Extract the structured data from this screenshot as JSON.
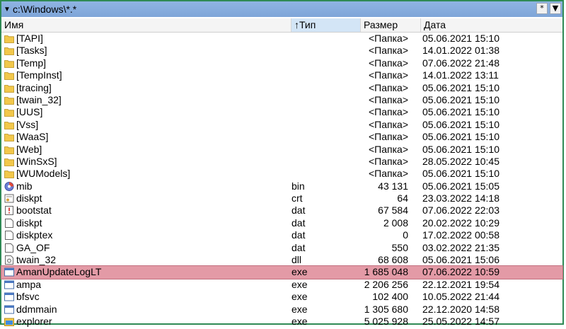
{
  "path": "c:\\Windows\\*.*",
  "buttons": [
    "*",
    "▼"
  ],
  "columns": {
    "name": "Имя",
    "type": "↑Тип",
    "size": "Размер",
    "date": "Дата"
  },
  "rows": [
    {
      "icon": "folder",
      "name": "[TAPI]",
      "ext": "",
      "size": "<Папка>",
      "date": "05.06.2021 15:10"
    },
    {
      "icon": "folder",
      "name": "[Tasks]",
      "ext": "",
      "size": "<Папка>",
      "date": "14.01.2022 01:38"
    },
    {
      "icon": "folder",
      "name": "[Temp]",
      "ext": "",
      "size": "<Папка>",
      "date": "07.06.2022 21:48"
    },
    {
      "icon": "folder",
      "name": "[TempInst]",
      "ext": "",
      "size": "<Папка>",
      "date": "14.01.2022 13:11"
    },
    {
      "icon": "folder",
      "name": "[tracing]",
      "ext": "",
      "size": "<Папка>",
      "date": "05.06.2021 15:10"
    },
    {
      "icon": "folder",
      "name": "[twain_32]",
      "ext": "",
      "size": "<Папка>",
      "date": "05.06.2021 15:10"
    },
    {
      "icon": "folder",
      "name": "[UUS]",
      "ext": "",
      "size": "<Папка>",
      "date": "05.06.2021 15:10"
    },
    {
      "icon": "folder",
      "name": "[Vss]",
      "ext": "",
      "size": "<Папка>",
      "date": "05.06.2021 15:10"
    },
    {
      "icon": "folder",
      "name": "[WaaS]",
      "ext": "",
      "size": "<Папка>",
      "date": "05.06.2021 15:10"
    },
    {
      "icon": "folder",
      "name": "[Web]",
      "ext": "",
      "size": "<Папка>",
      "date": "05.06.2021 15:10"
    },
    {
      "icon": "folder",
      "name": "[WinSxS]",
      "ext": "",
      "size": "<Папка>",
      "date": "28.05.2022 10:45"
    },
    {
      "icon": "folder",
      "name": "[WUModels]",
      "ext": "",
      "size": "<Папка>",
      "date": "05.06.2021 15:10"
    },
    {
      "icon": "disc",
      "name": "mib",
      "ext": "bin",
      "size": "43 131",
      "date": "05.06.2021 15:05"
    },
    {
      "icon": "cert",
      "name": "diskpt",
      "ext": "crt",
      "size": "64",
      "date": "23.03.2022 14:18"
    },
    {
      "icon": "alert",
      "name": "bootstat",
      "ext": "dat",
      "size": "67 584",
      "date": "07.06.2022 22:03"
    },
    {
      "icon": "file",
      "name": "diskpt",
      "ext": "dat",
      "size": "2 008",
      "date": "20.02.2022 10:29"
    },
    {
      "icon": "file",
      "name": "diskptex",
      "ext": "dat",
      "size": "0",
      "date": "17.02.2022 00:58"
    },
    {
      "icon": "file",
      "name": "GA_OF",
      "ext": "dat",
      "size": "550",
      "date": "03.02.2022 21:35"
    },
    {
      "icon": "dll",
      "name": "twain_32",
      "ext": "dll",
      "size": "68 608",
      "date": "05.06.2021 15:06"
    },
    {
      "icon": "exe",
      "name": "AmanUpdateLogLT",
      "ext": "exe",
      "size": "1 685 048",
      "date": "07.06.2022 10:59",
      "selected": true
    },
    {
      "icon": "exe",
      "name": "ampa",
      "ext": "exe",
      "size": "2 206 256",
      "date": "22.12.2021 19:54"
    },
    {
      "icon": "exe",
      "name": "bfsvc",
      "ext": "exe",
      "size": "102 400",
      "date": "10.05.2022 21:44"
    },
    {
      "icon": "exe",
      "name": "ddmmain",
      "ext": "exe",
      "size": "1 305 680",
      "date": "22.12.2020 14:58"
    },
    {
      "icon": "explorer",
      "name": "explorer",
      "ext": "exe",
      "size": "5 025 928",
      "date": "25.05.2022 14:57"
    }
  ],
  "colors": {
    "selected_row": "#e39aa6",
    "folder": "#f2c84b",
    "path_bar": "#8fb4e3",
    "frame": "#2f8a55"
  }
}
